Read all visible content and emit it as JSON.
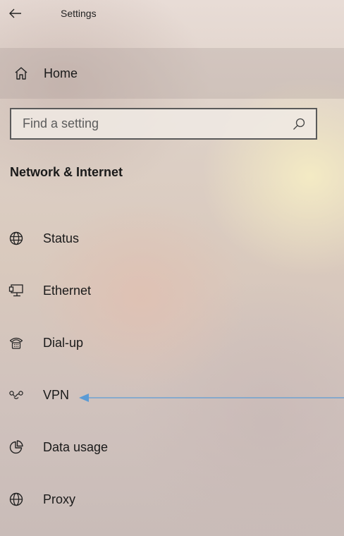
{
  "window": {
    "title": "Settings"
  },
  "home": {
    "label": "Home"
  },
  "search": {
    "placeholder": "Find a setting"
  },
  "section": {
    "title": "Network & Internet"
  },
  "nav": {
    "items": [
      {
        "label": "Status",
        "icon": "globe-status-icon"
      },
      {
        "label": "Ethernet",
        "icon": "ethernet-monitor-icon"
      },
      {
        "label": "Dial-up",
        "icon": "dial-up-phone-icon"
      },
      {
        "label": "VPN",
        "icon": "vpn-icon"
      },
      {
        "label": "Data usage",
        "icon": "data-usage-pie-icon"
      },
      {
        "label": "Proxy",
        "icon": "globe-icon"
      }
    ]
  },
  "colors": {
    "annotation_arrow": "#5b9bd5"
  }
}
